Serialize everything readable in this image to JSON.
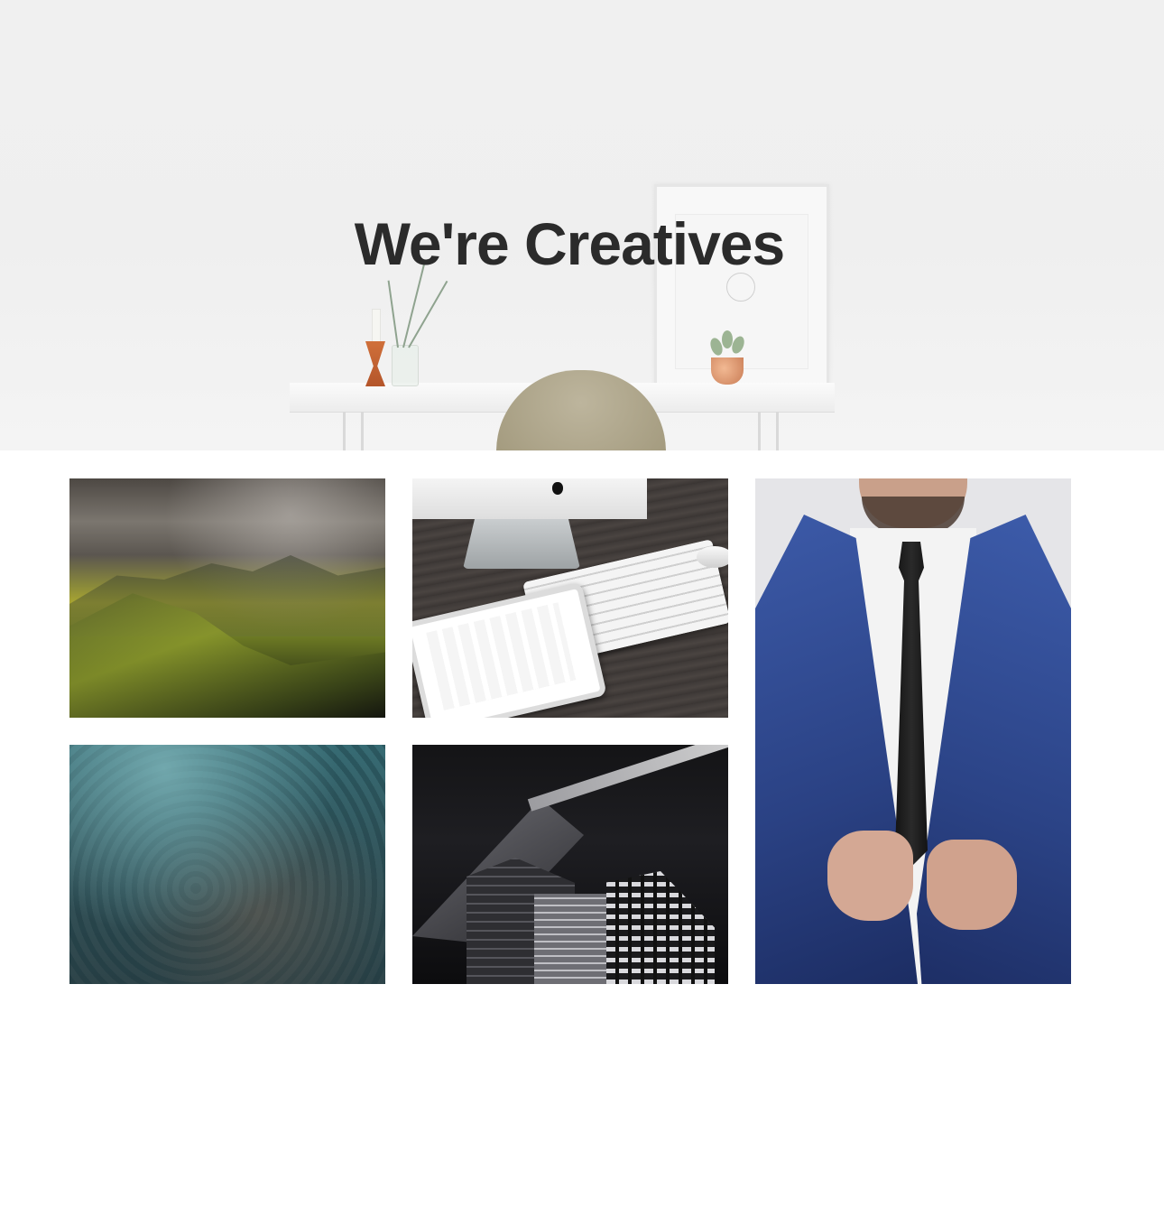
{
  "hero": {
    "title": "We're Creatives"
  },
  "gallery": {
    "items": [
      {
        "name": "mountain-landscape-photo"
      },
      {
        "name": "desk-workspace-photo"
      },
      {
        "name": "businessman-suit-photo"
      },
      {
        "name": "aerial-terrain-photo"
      },
      {
        "name": "dark-architecture-photo"
      }
    ]
  }
}
